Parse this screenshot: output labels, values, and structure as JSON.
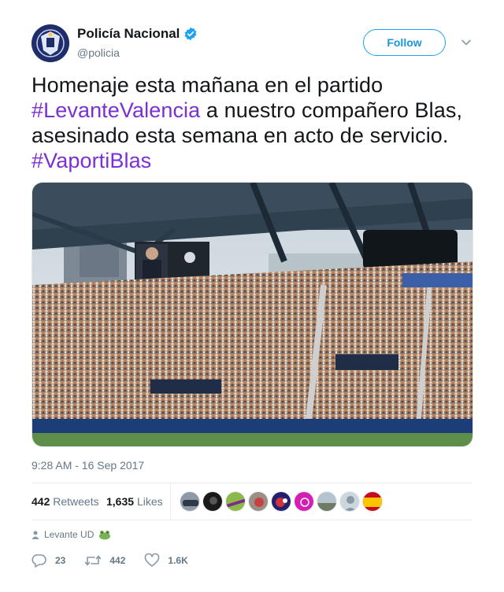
{
  "colors": {
    "link": "#7b2fd6",
    "twitter_blue": "#1da1f2",
    "text_secondary": "#657786",
    "text_primary": "#14171a"
  },
  "header": {
    "display_name": "Policía Nacional",
    "handle": "@policia",
    "follow_label": "Follow",
    "avatar_icon": "police-badge-icon",
    "verified_icon": "verified-badge-icon",
    "menu_icon": "chevron-down-icon"
  },
  "tweet": {
    "text_1": "Homenaje esta mañana en el partido ",
    "hashtag_1": "#LevanteValencia",
    "text_2": " a nuestro compañero Blas, asesinado esta semana en acto de servicio. ",
    "hashtag_2": "#VaportiBlas",
    "image_icon": "stadium-photo",
    "timestamp": "9:28 AM - 16 Sep 2017"
  },
  "stats": {
    "retweets_count": "442",
    "retweets_label": "Retweets",
    "likes_count": "1,635",
    "likes_label": "Likes"
  },
  "context": {
    "text": "Levante UD",
    "icon": "person-icon",
    "emoji_icon": "frog-icon"
  },
  "actions": {
    "reply_count": "23",
    "retweet_count": "442",
    "like_count": "1.6K"
  }
}
